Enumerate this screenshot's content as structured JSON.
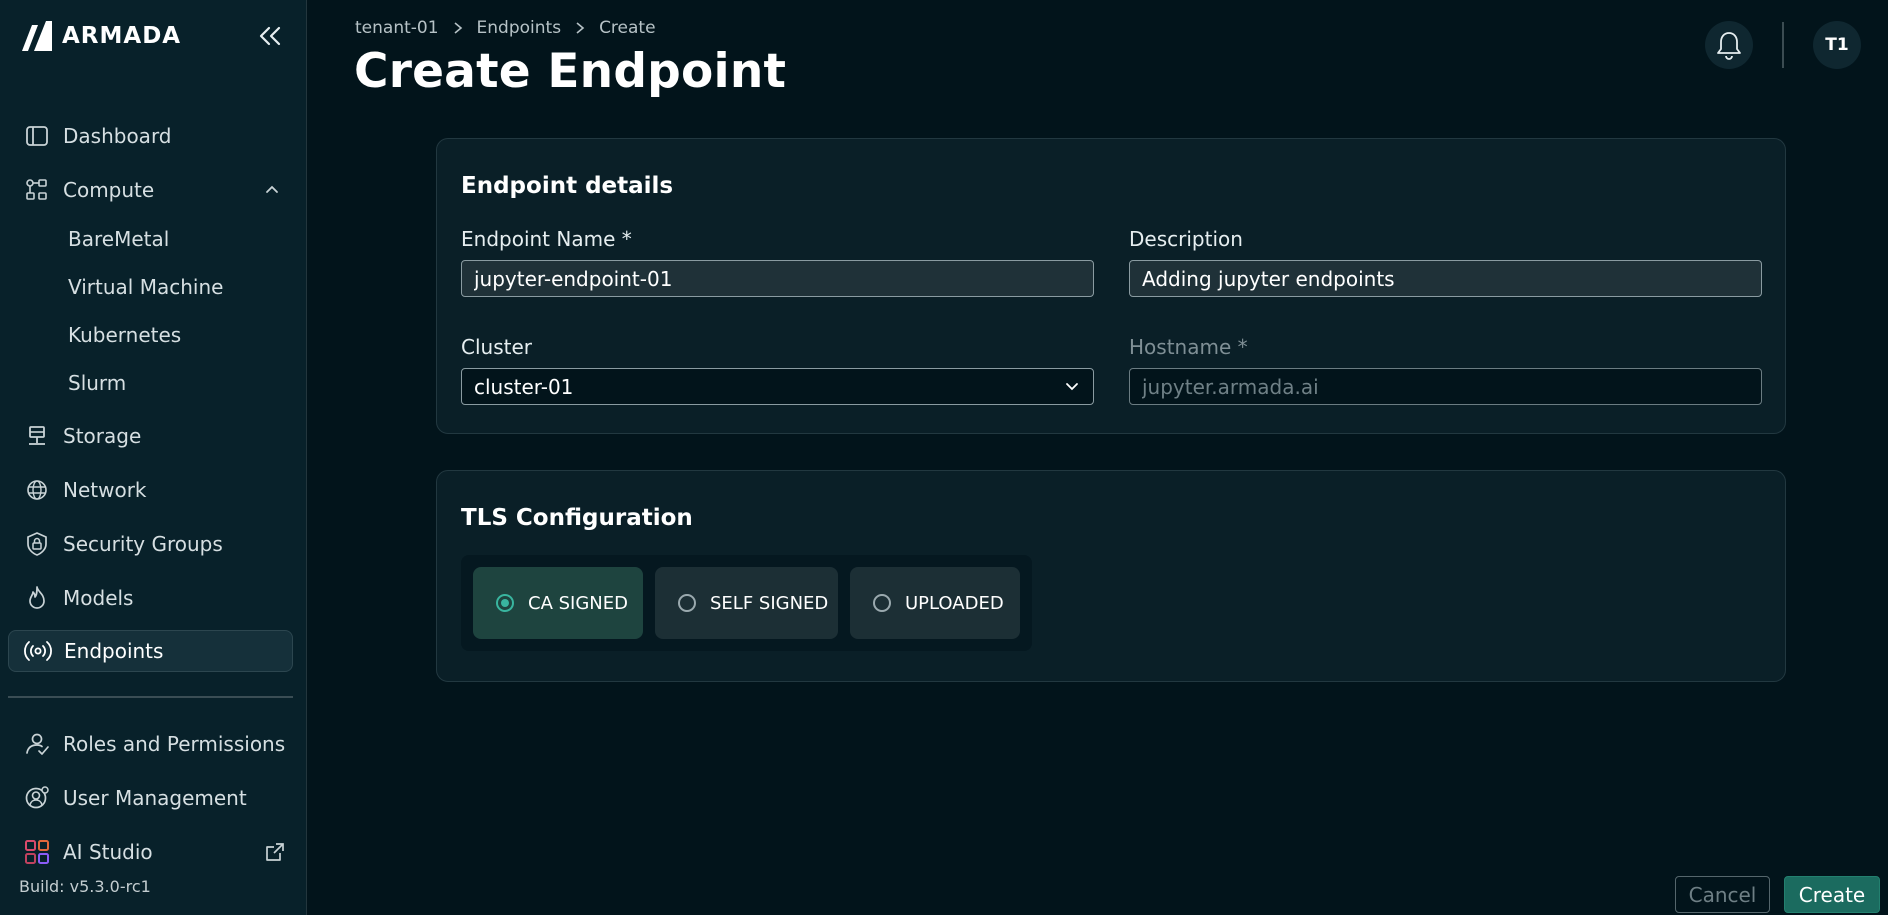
{
  "brand": {
    "name": "ARMADA"
  },
  "sidebar": {
    "items": [
      {
        "label": "Dashboard",
        "icon": "dashboard-icon"
      },
      {
        "label": "Compute",
        "icon": "compute-icon",
        "children": [
          {
            "label": "BareMetal"
          },
          {
            "label": "Virtual Machine"
          },
          {
            "label": "Kubernetes"
          },
          {
            "label": "Slurm"
          }
        ]
      },
      {
        "label": "Storage",
        "icon": "storage-icon"
      },
      {
        "label": "Network",
        "icon": "globe-icon"
      },
      {
        "label": "Security Groups",
        "icon": "shield-lock-icon"
      },
      {
        "label": "Models",
        "icon": "flame-icon"
      },
      {
        "label": "Endpoints",
        "icon": "broadcast-icon",
        "active": true
      }
    ],
    "bottom_items": [
      {
        "label": "Roles and Permissions",
        "icon": "user-check-icon"
      },
      {
        "label": "User Management",
        "icon": "user-gear-icon"
      },
      {
        "label": "AI Studio",
        "icon": "grid-apps-icon",
        "external": true
      }
    ],
    "build": "Build: v5.3.0-rc1"
  },
  "header": {
    "breadcrumb": [
      "tenant-01",
      "Endpoints",
      "Create"
    ],
    "title": "Create Endpoint",
    "avatar_initials": "T1"
  },
  "details": {
    "title": "Endpoint details",
    "name_label": "Endpoint Name *",
    "name_value": "jupyter-endpoint-01",
    "description_label": "Description",
    "description_value": "Adding jupyter endpoints",
    "cluster_label": "Cluster",
    "cluster_value": "cluster-01",
    "hostname_label": "Hostname *",
    "hostname_placeholder": "jupyter.armada.ai"
  },
  "tls": {
    "title": "TLS Configuration",
    "options": [
      "CA SIGNED",
      "SELF SIGNED",
      "UPLOADED"
    ],
    "selected": "CA SIGNED"
  },
  "actions": {
    "cancel": "Cancel",
    "create": "Create"
  },
  "colors": {
    "accent": "#1b6b5f",
    "selected_bg": "#1e443f",
    "radio": "#39b59f",
    "background": "#02141b"
  }
}
